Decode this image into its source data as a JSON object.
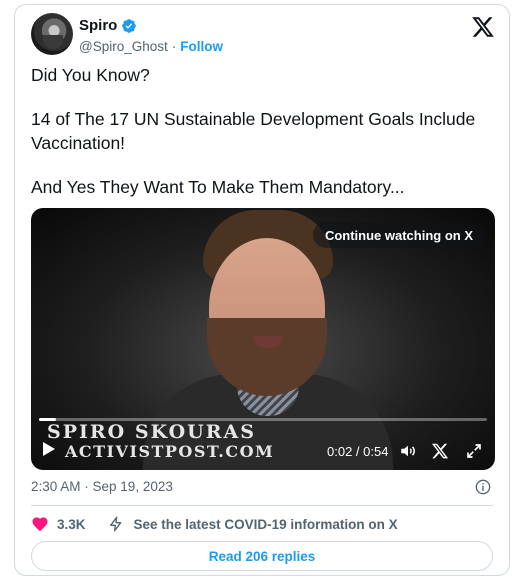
{
  "author": {
    "name": "Spiro",
    "handle": "@Spiro_Ghost",
    "separator": "·",
    "follow_label": "Follow",
    "verified": true
  },
  "tweet": {
    "paragraphs": [
      "Did You Know?",
      "14 of The 17 UN Sustainable Development Goals Include Vaccination!",
      "And Yes They Want To Make Them Mandatory..."
    ],
    "timestamp": "2:30 AM · Sep 19, 2023"
  },
  "video": {
    "continue_label": "Continue watching on X",
    "lower_third_name": "SPIRO SKOURAS",
    "lower_third_site": "ACTIVISTPOST.COM",
    "time_display": "0:02 / 0:54",
    "progress_fraction": 0.037
  },
  "actions": {
    "likes_count": "3.3K",
    "covid_info": "See the latest COVID-19 information on X",
    "read_replies_label": "Read 206 replies"
  },
  "colors": {
    "accent": "#1d9bf0",
    "like": "#f91880",
    "text": "#0f1419",
    "muted": "#536471",
    "border": "#cfd9de"
  },
  "icons": [
    "verified-badge-icon",
    "x-logo-icon",
    "play-icon",
    "volume-icon",
    "mute-x-icon",
    "fullscreen-icon",
    "info-icon",
    "heart-icon",
    "bolt-icon"
  ]
}
